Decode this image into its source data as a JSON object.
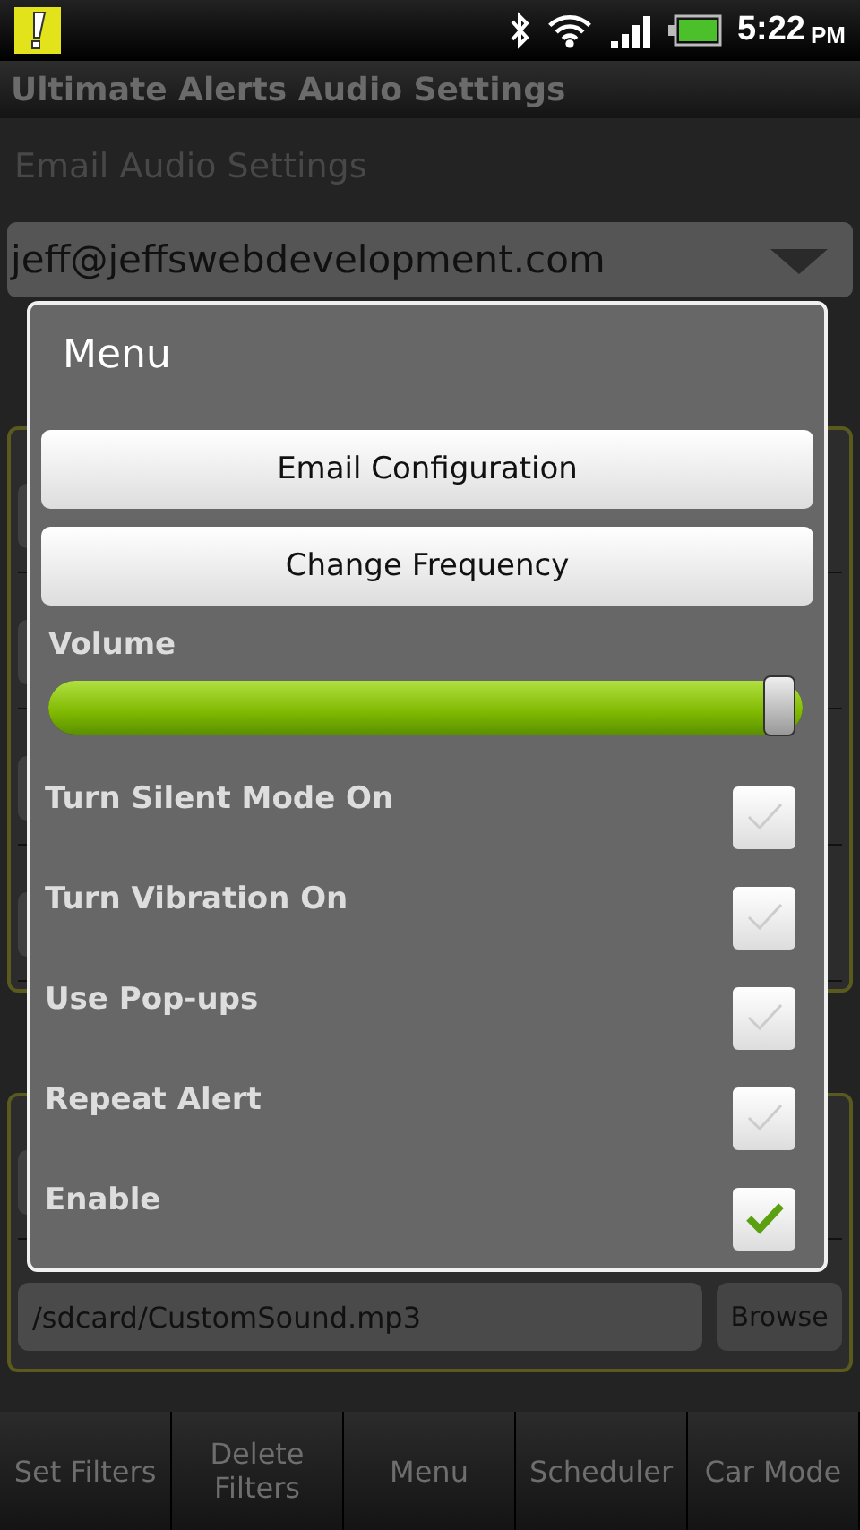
{
  "status_bar": {
    "time": "5:22",
    "ampm": "PM"
  },
  "title": "Ultimate Alerts Audio Settings",
  "section_title": "Email Audio Settings",
  "account_spinner": {
    "value": "jeff@jeffswebdevelopment.com"
  },
  "file_field": {
    "value": "/sdcard/CustomSound.mp3"
  },
  "browse_button": "Browse",
  "dialog": {
    "title": "Menu",
    "buttons": [
      "Email Configuration",
      "Change Frequency"
    ],
    "volume": {
      "label": "Volume",
      "level": 1.0
    },
    "options": [
      {
        "label": "Turn Silent Mode On",
        "checked": false
      },
      {
        "label": "Turn Vibration On",
        "checked": false
      },
      {
        "label": "Use Pop-ups",
        "checked": false
      },
      {
        "label": "Repeat Alert",
        "checked": false
      },
      {
        "label": "Enable",
        "checked": true
      }
    ]
  },
  "bottom_bar": [
    "Set Filters",
    "Delete Filters",
    "Menu",
    "Scheduler",
    "Car Mode"
  ]
}
